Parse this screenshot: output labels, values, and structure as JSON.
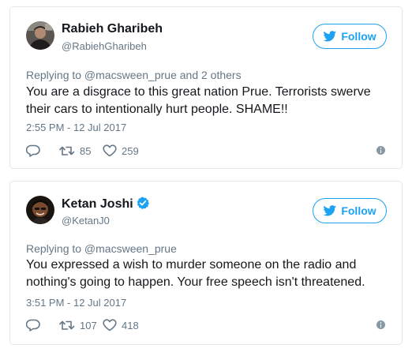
{
  "colors": {
    "accent": "#1da1f2",
    "text": "#14171a",
    "muted": "#657786",
    "border": "#e1e8ed"
  },
  "tweets": [
    {
      "name": "Rabieh Gharibeh",
      "handle": "@RabiehGharibeh",
      "verified": false,
      "follow_label": "Follow",
      "replying_to": "Replying to @macsween_prue and 2 others",
      "text": "You are a disgrace to this great nation Prue. Terrorists swerve their cars to intentionally hurt people. SHAME!!",
      "timestamp": "2:55 PM - 12 Jul 2017",
      "retweets": "85",
      "likes": "259",
      "icons": [
        "avatar",
        "follow-bird-icon",
        "reply-icon",
        "retweet-icon",
        "like-heart-icon",
        "info-icon"
      ]
    },
    {
      "name": "Ketan Joshi",
      "handle": "@KetanJ0",
      "verified": true,
      "follow_label": "Follow",
      "replying_to": "Replying to @macsween_prue",
      "text": "You expressed a wish to murder someone on the radio and nothing's going to happen. Your free speech isn't threatened.",
      "timestamp": "3:51 PM - 12 Jul 2017",
      "retweets": "107",
      "likes": "418",
      "icons": [
        "avatar",
        "verified-badge-icon",
        "follow-bird-icon",
        "reply-icon",
        "retweet-icon",
        "like-heart-icon",
        "info-icon"
      ]
    }
  ]
}
